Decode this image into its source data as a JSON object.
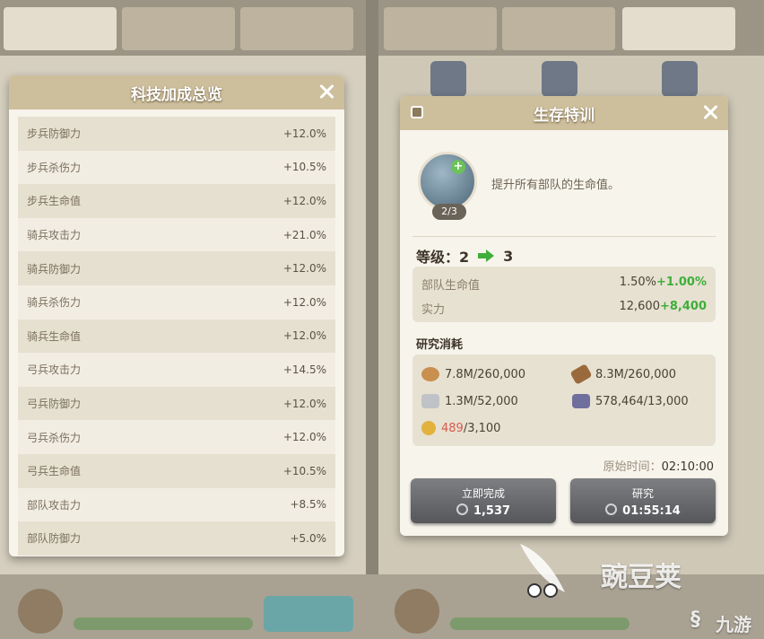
{
  "left_panel": {
    "title": "科技加成总览",
    "rows": [
      {
        "label": "步兵防御力",
        "value": "+12.0%"
      },
      {
        "label": "步兵杀伤力",
        "value": "+10.5%"
      },
      {
        "label": "步兵生命值",
        "value": "+12.0%"
      },
      {
        "label": "骑兵攻击力",
        "value": "+21.0%"
      },
      {
        "label": "骑兵防御力",
        "value": "+12.0%"
      },
      {
        "label": "骑兵杀伤力",
        "value": "+12.0%"
      },
      {
        "label": "骑兵生命值",
        "value": "+12.0%"
      },
      {
        "label": "弓兵攻击力",
        "value": "+14.5%"
      },
      {
        "label": "弓兵防御力",
        "value": "+12.0%"
      },
      {
        "label": "弓兵杀伤力",
        "value": "+12.0%"
      },
      {
        "label": "弓兵生命值",
        "value": "+10.5%"
      },
      {
        "label": "部队攻击力",
        "value": "+8.5%"
      },
      {
        "label": "部队防御力",
        "value": "+5.0%"
      }
    ]
  },
  "right_panel": {
    "title": "生存特训",
    "skill_level_badge": "2/3",
    "description": "提升所有部队的生命值。",
    "level_label": "等级：",
    "level_from": "2",
    "level_to": "3",
    "stats": [
      {
        "label": "部队生命值",
        "value": "1.50%",
        "add": "+1.00%"
      },
      {
        "label": "实力",
        "value": "12,600",
        "add": "+8,400"
      }
    ],
    "cost_title": "研究消耗",
    "costs": {
      "food": "7.8M/260,000",
      "wood": "8.3M/260,000",
      "stone": "1.3M/52,000",
      "ore": "578,464/13,000",
      "gold_have": "489",
      "gold_need": "/3,100"
    },
    "start_time_label": "原始时间：",
    "start_time_value": "02:10:00",
    "instant_button": {
      "label": "立即完成",
      "value": "1,537"
    },
    "research_button": {
      "label": "研究",
      "value": "01:55:14"
    }
  },
  "watermarks": {
    "left": "豌豆荚",
    "right": "九游"
  },
  "colors": {
    "header": "#cdbf9c",
    "positive": "#3fae3a",
    "shortage": "#d65a4a"
  }
}
